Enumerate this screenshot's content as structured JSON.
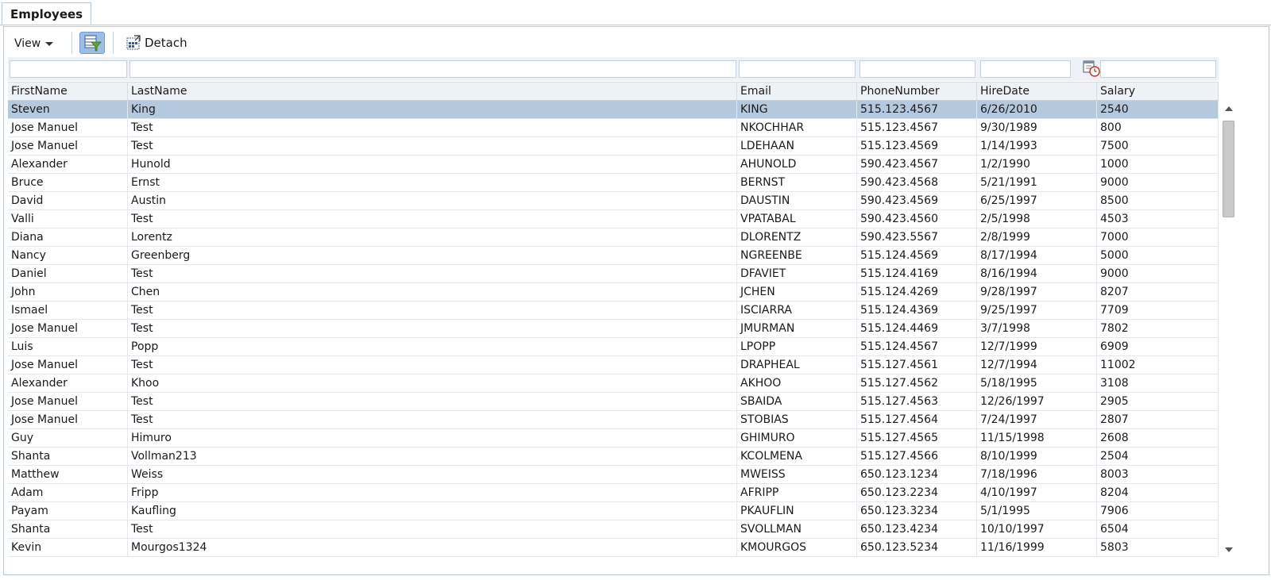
{
  "tab": {
    "label": "Employees"
  },
  "toolbar": {
    "view_label": "View",
    "detach_label": "Detach"
  },
  "columns": [
    "FirstName",
    "LastName",
    "Email",
    "PhoneNumber",
    "HireDate",
    "Salary"
  ],
  "rows": [
    [
      "Steven",
      "King",
      "KING",
      "515.123.4567",
      "6/26/2010",
      "2540"
    ],
    [
      "Jose Manuel",
      "Test",
      "NKOCHHAR",
      "515.123.4567",
      "9/30/1989",
      "800"
    ],
    [
      "Jose Manuel",
      "Test",
      "LDEHAAN",
      "515.123.4569",
      "1/14/1993",
      "7500"
    ],
    [
      "Alexander",
      "Hunold",
      "AHUNOLD",
      "590.423.4567",
      "1/2/1990",
      "1000"
    ],
    [
      "Bruce",
      "Ernst",
      "BERNST",
      "590.423.4568",
      "5/21/1991",
      "9000"
    ],
    [
      "David",
      "Austin",
      "DAUSTIN",
      "590.423.4569",
      "6/25/1997",
      "8500"
    ],
    [
      "Valli",
      "Test",
      "VPATABAL",
      "590.423.4560",
      "2/5/1998",
      "4503"
    ],
    [
      "Diana",
      "Lorentz",
      "DLORENTZ",
      "590.423.5567",
      "2/8/1999",
      "7000"
    ],
    [
      "Nancy",
      "Greenberg",
      "NGREENBE",
      "515.124.4569",
      "8/17/1994",
      "5000"
    ],
    [
      "Daniel",
      "Test",
      "DFAVIET",
      "515.124.4169",
      "8/16/1994",
      "9000"
    ],
    [
      "John",
      "Chen",
      "JCHEN",
      "515.124.4269",
      "9/28/1997",
      "8207"
    ],
    [
      "Ismael",
      "Test",
      "ISCIARRA",
      "515.124.4369",
      "9/25/1997",
      "7709"
    ],
    [
      "Jose Manuel",
      "Test",
      "JMURMAN",
      "515.124.4469",
      "3/7/1998",
      "7802"
    ],
    [
      "Luis",
      "Popp",
      "LPOPP",
      "515.124.4567",
      "12/7/1999",
      "6909"
    ],
    [
      "Jose Manuel",
      "Test",
      "DRAPHEAL",
      "515.127.4561",
      "12/7/1994",
      "11002"
    ],
    [
      "Alexander",
      "Khoo",
      "AKHOO",
      "515.127.4562",
      "5/18/1995",
      "3108"
    ],
    [
      "Jose Manuel",
      "Test",
      "SBAIDA",
      "515.127.4563",
      "12/26/1997",
      "2905"
    ],
    [
      "Jose Manuel",
      "Test",
      "STOBIAS",
      "515.127.4564",
      "7/24/1997",
      "2807"
    ],
    [
      "Guy",
      "Himuro",
      "GHIMURO",
      "515.127.4565",
      "11/15/1998",
      "2608"
    ],
    [
      "Shanta",
      "Vollman213",
      "KCOLMENA",
      "515.127.4566",
      "8/10/1999",
      "2504"
    ],
    [
      "Matthew",
      "Weiss",
      "MWEISS",
      "650.123.1234",
      "7/18/1996",
      "8003"
    ],
    [
      "Adam",
      "Fripp",
      "AFRIPP",
      "650.123.2234",
      "4/10/1997",
      "8204"
    ],
    [
      "Payam",
      "Kaufling",
      "PKAUFLIN",
      "650.123.3234",
      "5/1/1995",
      "7906"
    ],
    [
      "Shanta",
      "Test",
      "SVOLLMAN",
      "650.123.4234",
      "10/10/1997",
      "6504"
    ],
    [
      "Kevin",
      "Mourgos1324",
      "KMOURGOS",
      "650.123.5234",
      "11/16/1999",
      "5803"
    ]
  ],
  "selected_row": 0,
  "colors": {
    "selected": "#b4c8de",
    "header_bg": "#eef2f6",
    "border": "#b9c7d6"
  }
}
